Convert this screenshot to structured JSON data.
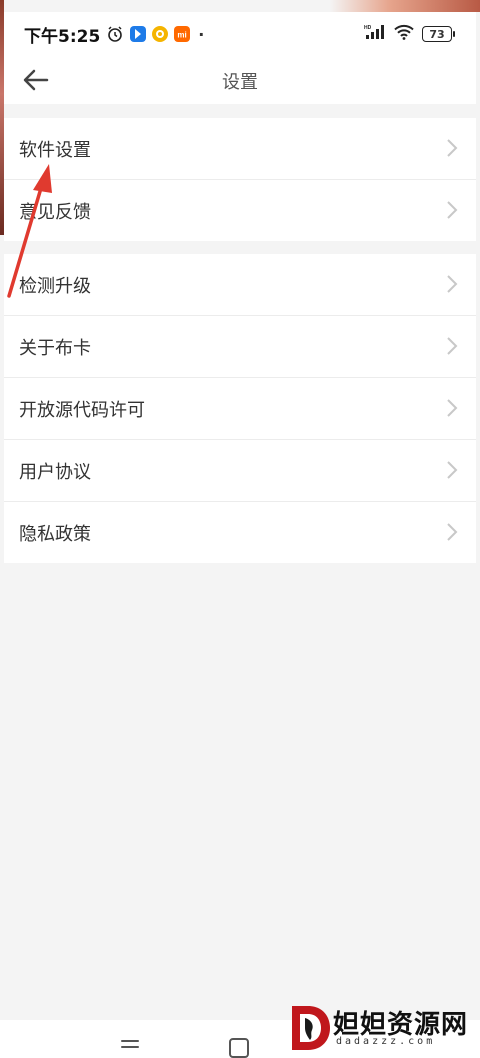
{
  "status_bar": {
    "time": "下午5:25",
    "battery_level": "73",
    "dot": "·"
  },
  "header": {
    "title": "设置"
  },
  "groups": [
    {
      "items": [
        {
          "label": "软件设置"
        },
        {
          "label": "意见反馈"
        }
      ]
    },
    {
      "items": [
        {
          "label": "检测升级"
        },
        {
          "label": "关于布卡"
        },
        {
          "label": "开放源代码许可"
        },
        {
          "label": "用户协议"
        },
        {
          "label": "隐私政策"
        }
      ]
    }
  ],
  "watermark": {
    "text": "妲妲资源网",
    "sub": "dadazzz.com"
  },
  "colors": {
    "accent_arrow": "#e03a2f",
    "background": "#f4f4f4",
    "row_bg": "#ffffff"
  }
}
